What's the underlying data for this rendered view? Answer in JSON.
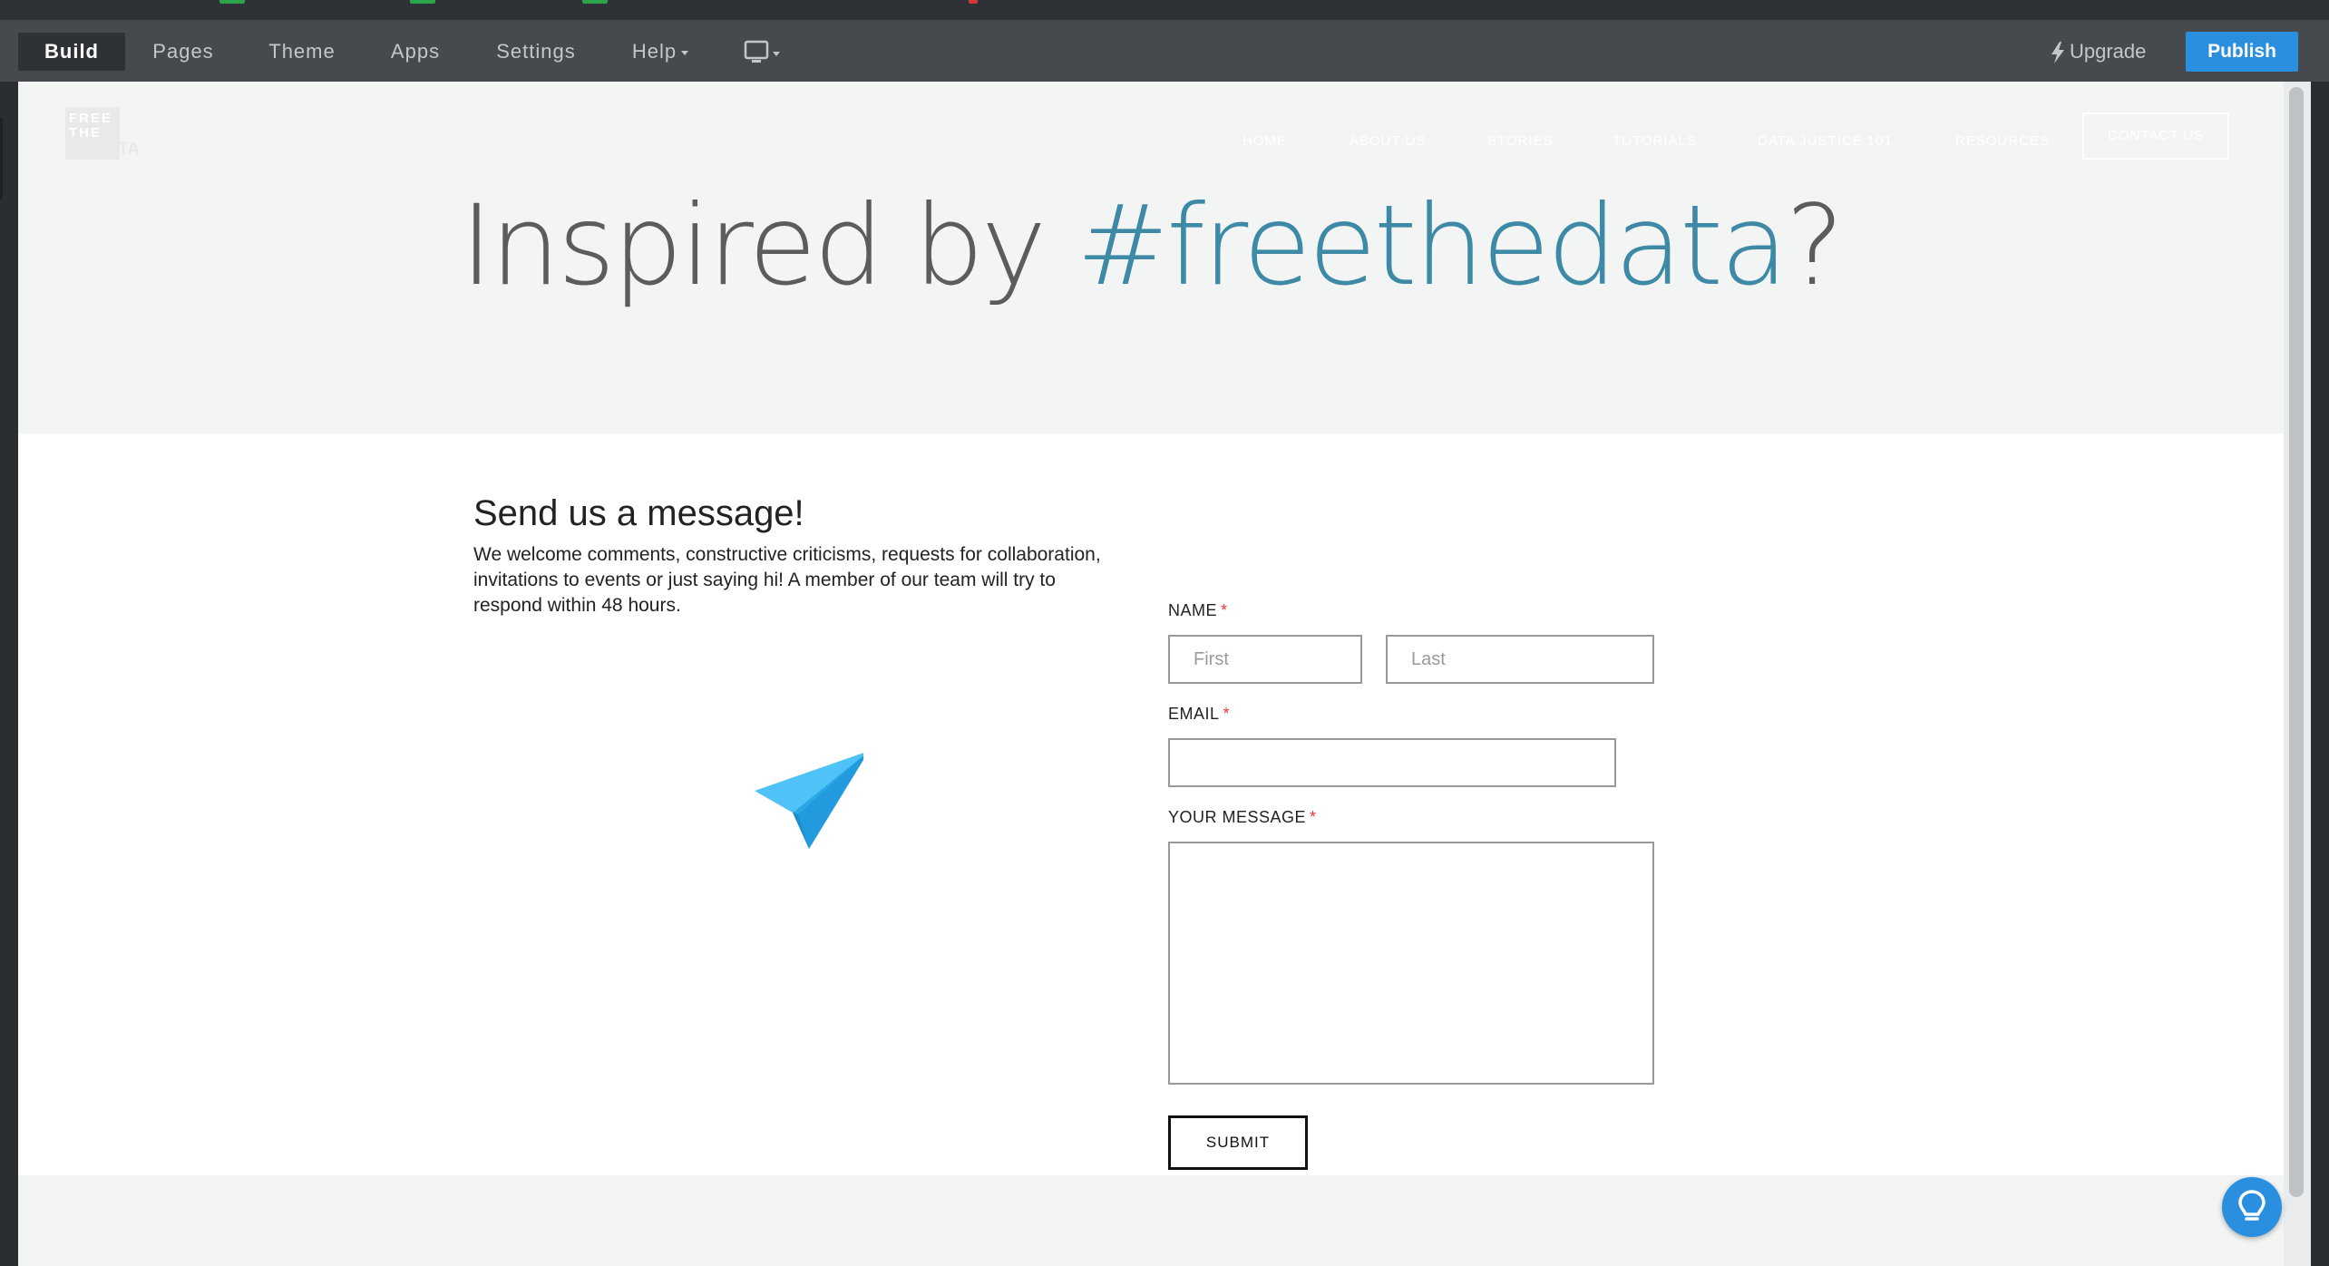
{
  "colors": {
    "toolbar_bg": "#464a4e",
    "active_tab_bg": "#2e3135",
    "publish_bg": "#2b8fe0",
    "hero_accent": "#3e8aa6",
    "required_mark": "#e53935"
  },
  "editor": {
    "tabs": [
      {
        "label": "Build",
        "active": true
      },
      {
        "label": "Pages"
      },
      {
        "label": "Theme"
      },
      {
        "label": "Apps"
      },
      {
        "label": "Settings"
      },
      {
        "label": "Help"
      }
    ],
    "device_icon": "desktop-monitor-icon",
    "upgrade_label": "Upgrade",
    "upgrade_icon": "lightning-bolt-icon",
    "publish_label": "Publish"
  },
  "site": {
    "logo_text": "FREE THE DATA",
    "nav": [
      "HOME",
      "ABOUT US",
      "STORIES",
      "TUTORIALS",
      "DATA JUSTICE 101",
      "RESOURCES"
    ],
    "nav_cta": "CONTACT US",
    "hero_prefix": "Inspired by ",
    "hero_accent": "#freethedata",
    "hero_suffix": "?"
  },
  "contact": {
    "title": "Send us a message!",
    "body": "We welcome comments, constructive criticisms, requests for collaboration, invitations to events or just saying hi! A member of our team will try to respond within 48 hours.",
    "illustration": "paper-plane-icon",
    "name_label": "NAME",
    "first_placeholder": "First",
    "last_placeholder": "Last",
    "email_label": "EMAIL",
    "message_label": "YOUR MESSAGE",
    "required_mark": "*",
    "submit_label": "SUBMIT"
  },
  "help_widget_icon": "lightbulb-icon"
}
